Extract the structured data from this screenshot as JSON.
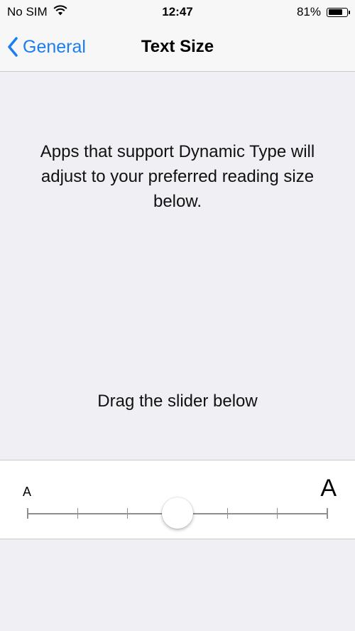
{
  "status_bar": {
    "carrier": "No SIM",
    "time": "12:47",
    "battery_percent_text": "81%",
    "battery_level": 0.81,
    "wifi_icon": "wifi-icon"
  },
  "nav": {
    "back_label": "General",
    "title": "Text Size"
  },
  "content": {
    "description": "Apps that support Dynamic Type will adjust to your preferred reading size below.",
    "hint": "Drag the slider below"
  },
  "slider": {
    "min_label": "A",
    "max_label": "A",
    "steps": 7,
    "selected_index": 3
  },
  "colors": {
    "accent": "#1a7ef0",
    "background": "#efeff4",
    "bar": "#f7f7f7",
    "separator": "#c8c7cc"
  }
}
